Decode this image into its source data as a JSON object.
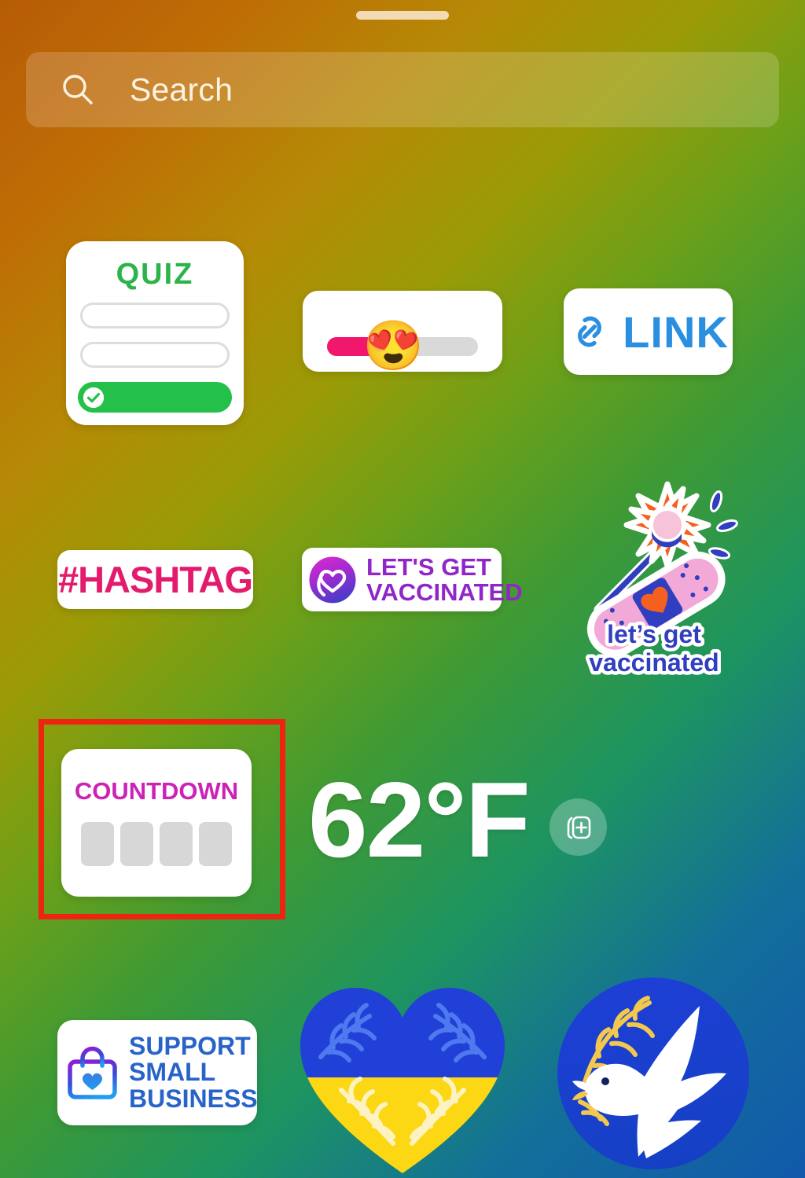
{
  "app": {
    "screen_name": "Instagram Stories sticker tray",
    "background_colors": {
      "top_left": "#b65c07",
      "mid": "#3f9a34",
      "bottom_right": "#1159ab"
    }
  },
  "drag_handle": {
    "name": "sheet-drag-handle",
    "color": "#f2dbb4"
  },
  "search": {
    "placeholder": "Search",
    "value": "",
    "icon": "search-icon",
    "text_color": "#fbf3e2"
  },
  "stickers": {
    "quiz": {
      "label": "QUIZ",
      "title_color": "#2cb34a",
      "options": [
        "",
        ""
      ],
      "correct_option": "",
      "correct_color": "#23c04a",
      "check_icon": "check-icon"
    },
    "emoji_slider": {
      "emoji": "😍",
      "emoji_name": "heart-eyes-emoji",
      "fill_percent": 48,
      "fill_color": "#f0176c",
      "track_color": "#d9d9d9"
    },
    "link": {
      "label": "LINK",
      "color": "#2a8fe0",
      "icon": "chain-link-icon"
    },
    "hashtag": {
      "label": "#HASHTAG",
      "color": "#e31b6d"
    },
    "vaccinated_badge": {
      "line1": "LET'S GET",
      "line2": "VACCINATED",
      "color": "#9126c8",
      "icon": "heart-ribbon-badge-icon"
    },
    "vaccinated_illustration": {
      "line1": "let's get",
      "line2": "vaccinated",
      "color": "#2f3fc0",
      "icon": "bandage-flower-icon"
    },
    "countdown": {
      "label": "COUNTDOWN",
      "color": "#cc22b5",
      "digits": [
        "",
        "",
        "",
        ""
      ],
      "digit_color": "#d7d7d7",
      "highlighted": true,
      "highlight_color": "#ee2411"
    },
    "temperature": {
      "value": "62°F",
      "color": "#ffffff"
    },
    "add_sticker_button": {
      "icon": "add-to-stack-icon",
      "label": ""
    },
    "support_small_business": {
      "line1": "SUPPORT",
      "line2": "SMALL",
      "line3": "BUSINESS",
      "color": "#2763c9",
      "icon": "shopping-bag-heart-icon"
    },
    "ukraine_heart": {
      "icon": "ukraine-flag-heart-icon",
      "top_color": "#2040d8",
      "bottom_color": "#fbd714"
    },
    "peace_dove": {
      "icon": "peace-dove-icon",
      "circle_color": "#1a3fd0",
      "bird_color": "#ffffff",
      "branch_color": "#f2c94c"
    }
  }
}
